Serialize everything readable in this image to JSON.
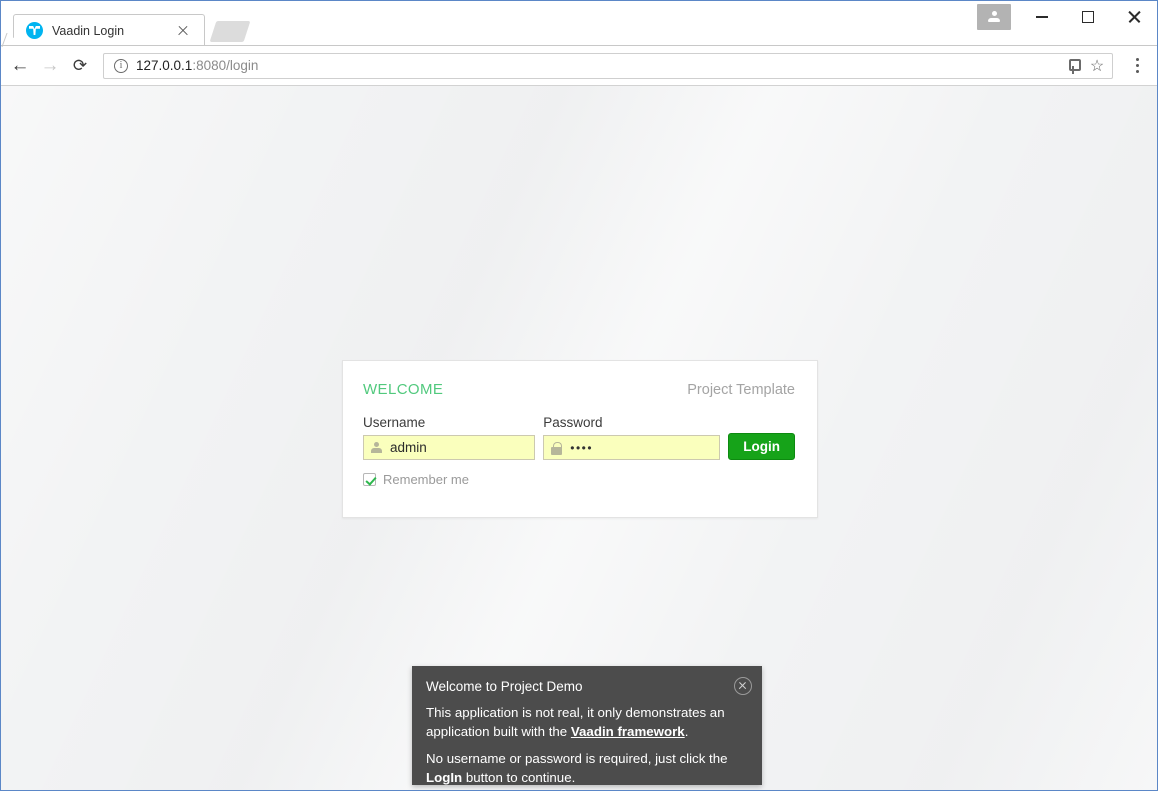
{
  "browser": {
    "tab": {
      "title": "Vaadin Login",
      "favicon": "vaadin-logo-icon",
      "close_icon": "close-icon"
    },
    "new_tab_icon": "new-tab-icon",
    "window_controls": {
      "profile_icon": "user-profile-icon",
      "minimize_icon": "minimize-icon",
      "maximize_icon": "maximize-icon",
      "close_icon": "close-icon"
    },
    "toolbar": {
      "back_icon": "←",
      "forward_icon": "→",
      "reload_icon": "⟳",
      "info_icon": "i",
      "url_host": "127.0.0.1",
      "url_rest": ":8080/login",
      "key_icon": "key-icon",
      "star_icon": "☆",
      "menu_icon": "three-dot-menu-icon"
    }
  },
  "login_card": {
    "welcome": "WELCOME",
    "brand": "Project Template",
    "username": {
      "label": "Username",
      "value": "admin",
      "placeholder": "Username",
      "icon": "person-icon"
    },
    "password": {
      "label": "Password",
      "value": "••••",
      "placeholder": "Password",
      "icon": "lock-icon"
    },
    "login_button": "Login",
    "remember": {
      "label": "Remember me",
      "checked": true
    },
    "colors": {
      "welcome": "#51c97d",
      "login_button": "#16a319",
      "autofill_field": "#faffbd"
    }
  },
  "toast": {
    "title": "Welcome to Project Demo",
    "paragraph_1_before": "This application is not real, it only demonstrates an application built with the ",
    "paragraph_1_link": "Vaadin framework",
    "paragraph_1_after": ".",
    "paragraph_2_before": "No username or password is required, just click the ",
    "paragraph_2_bold": "LogIn",
    "paragraph_2_after": " button to continue.",
    "close_icon": "close-icon",
    "background": "#4c4c4c"
  }
}
